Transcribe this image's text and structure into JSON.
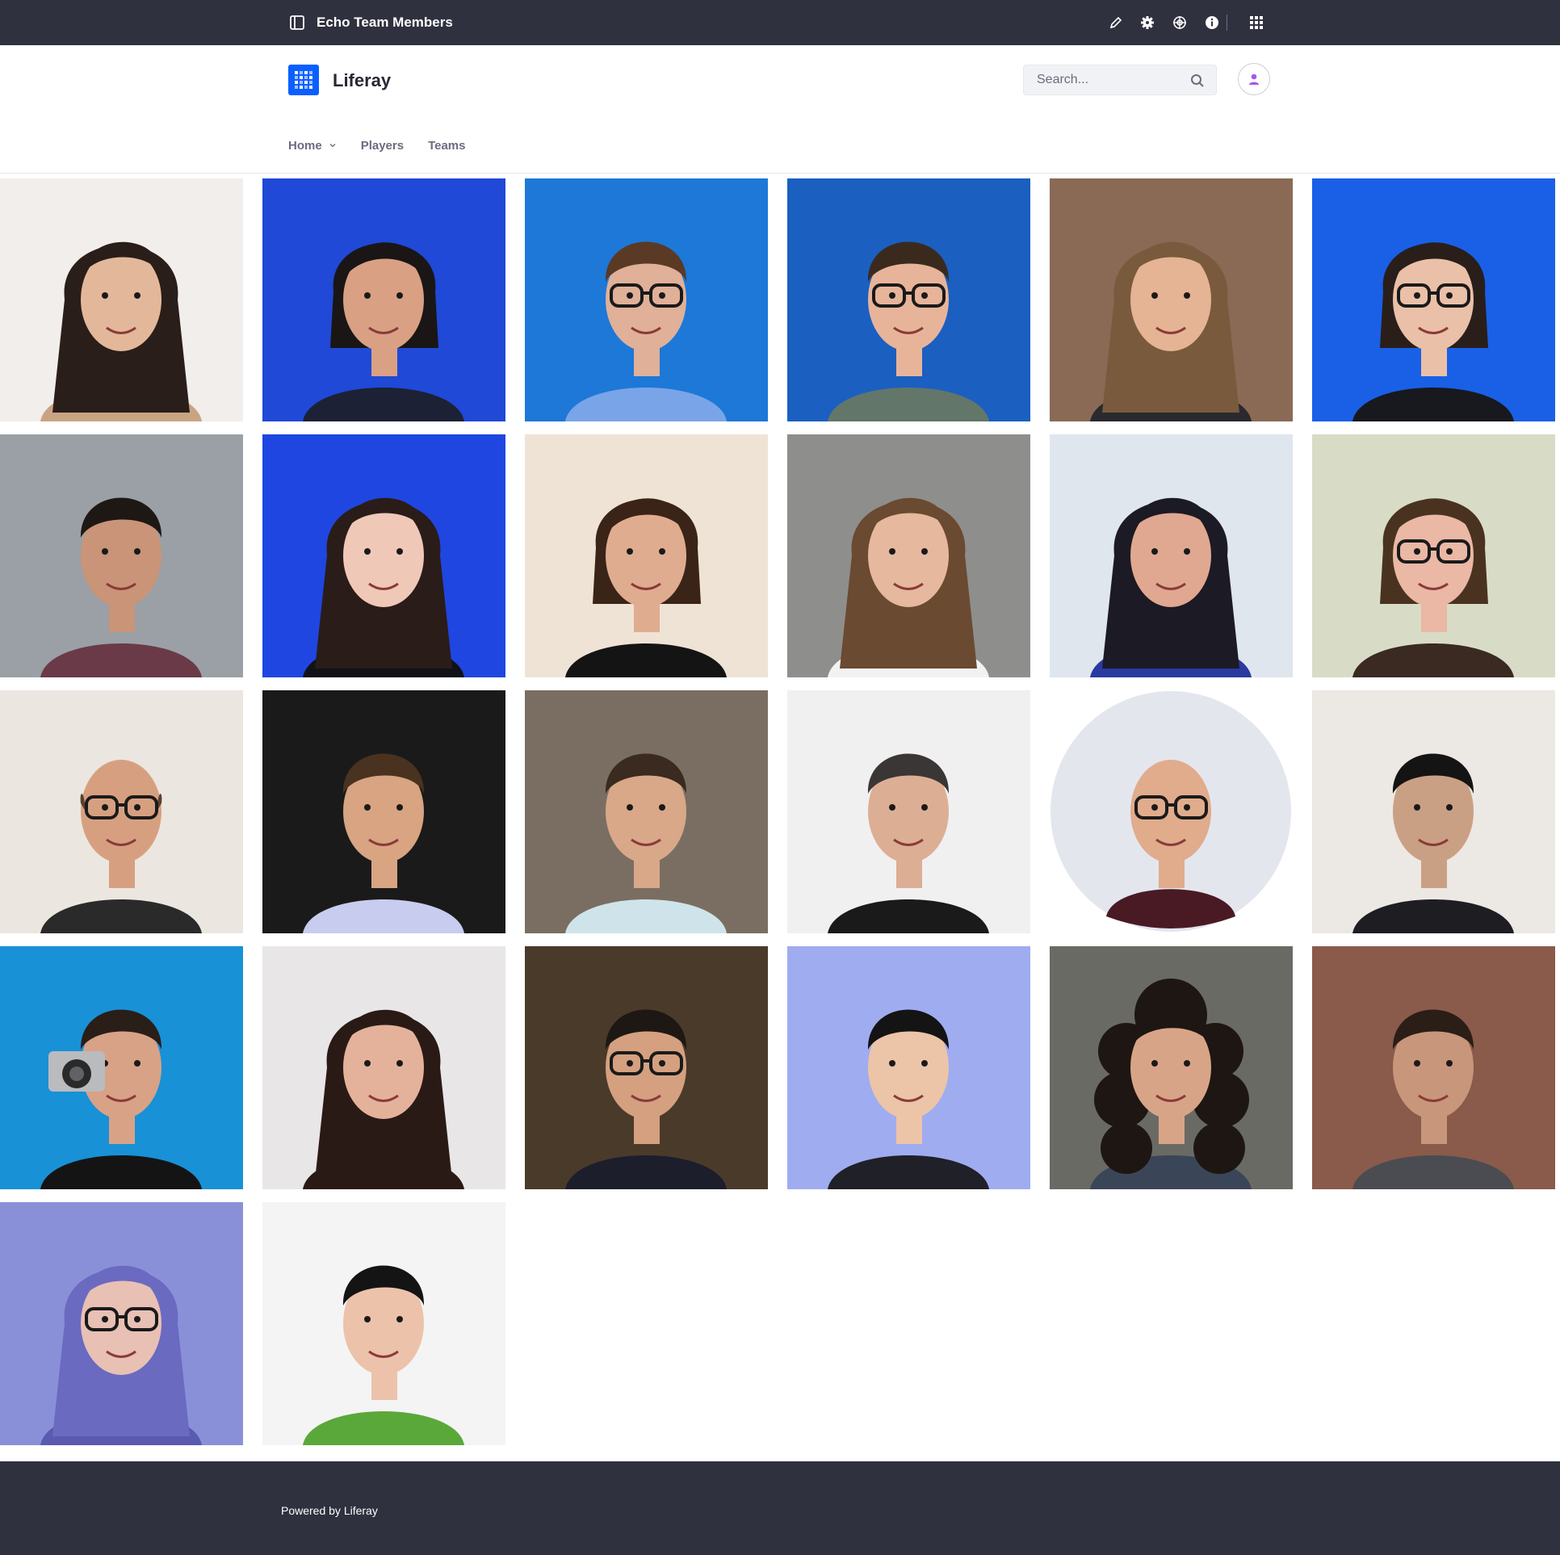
{
  "control_menu": {
    "title": "Echo Team Members",
    "icons": [
      "sidebar-toggle-icon",
      "pencil-icon",
      "gear-icon",
      "simulation-icon",
      "info-icon",
      "apps-grid-icon"
    ]
  },
  "header": {
    "site_name": "Liferay",
    "search_placeholder": "Search...",
    "nav": [
      {
        "label": "Home",
        "has_dropdown": true
      },
      {
        "label": "Players",
        "has_dropdown": false
      },
      {
        "label": "Teams",
        "has_dropdown": false
      }
    ]
  },
  "members": [
    {
      "bg": "#f1eeec",
      "skin": "#e3b89a",
      "hair": "#2a1e1a",
      "shirt": "#c9a483",
      "style": "long",
      "glasses": false
    },
    {
      "bg": "#1f49d6",
      "skin": "#d9a084",
      "hair": "#1a1616",
      "shirt": "#1c2135",
      "style": "bob",
      "glasses": false
    },
    {
      "bg": "#1d78d8",
      "skin": "#e0b098",
      "hair": "#5a3a24",
      "shirt": "#7aa4e8",
      "style": "short",
      "glasses": true
    },
    {
      "bg": "#1b5fc1",
      "skin": "#e7b49a",
      "hair": "#3a2a1e",
      "shirt": "#63766a",
      "style": "short",
      "glasses": true
    },
    {
      "bg": "#8a6a55",
      "skin": "#e4b494",
      "hair": "#7a5a3c",
      "shirt": "#2a2a2e",
      "style": "long",
      "glasses": false
    },
    {
      "bg": "#1960e6",
      "skin": "#eac0a8",
      "hair": "#2a1e1a",
      "shirt": "#18191e",
      "style": "bob",
      "glasses": true
    },
    {
      "bg": "#9aa0a6",
      "skin": "#c99478",
      "hair": "#1e1814",
      "shirt": "#6b3a48",
      "style": "short",
      "glasses": false
    },
    {
      "bg": "#1f46e0",
      "skin": "#f0c8b8",
      "hair": "#2a1c18",
      "shirt": "#111218",
      "style": "long",
      "glasses": false
    },
    {
      "bg": "#efe3d6",
      "skin": "#e0ac90",
      "hair": "#3a2418",
      "shirt": "#141414",
      "style": "bob",
      "glasses": false
    },
    {
      "bg": "#8e8e8c",
      "skin": "#e6b89e",
      "hair": "#6a4a30",
      "shirt": "#f2f2f2",
      "style": "long",
      "glasses": false
    },
    {
      "bg": "#dfe6ee",
      "skin": "#e0a890",
      "hair": "#1c1a24",
      "shirt": "#2a3aa0",
      "style": "long",
      "glasses": false
    },
    {
      "bg": "#d8dcc6",
      "skin": "#eab8a4",
      "hair": "#4a3220",
      "shirt": "#3a2a22",
      "style": "bob",
      "glasses": true
    },
    {
      "bg": "#ece6e0",
      "skin": "#d6a080",
      "hair": "#5a4030",
      "shirt": "#2a2a2a",
      "style": "bald",
      "glasses": true
    },
    {
      "bg": "#1a1a1a",
      "skin": "#d8a482",
      "hair": "#4a3220",
      "shirt": "#c8ccee",
      "style": "short",
      "glasses": false
    },
    {
      "bg": "#7a6e62",
      "skin": "#d8a888",
      "hair": "#3a2a20",
      "shirt": "#cfe4ea",
      "style": "short",
      "glasses": false
    },
    {
      "bg": "#f0f0f0",
      "skin": "#dcae94",
      "hair": "#3a3636",
      "shirt": "#1a1a1a",
      "style": "short",
      "glasses": false
    },
    {
      "bg": "#ffffff",
      "skin": "#e0ac8c",
      "hair": "#1e1814",
      "shirt": "#4a1a24",
      "style": "circle",
      "glasses": true
    },
    {
      "bg": "#ece8e4",
      "skin": "#caa084",
      "hair": "#141414",
      "shirt": "#1e1e22",
      "style": "short",
      "glasses": false
    },
    {
      "bg": "#1891d6",
      "skin": "#d8a286",
      "hair": "#2a1e18",
      "shirt": "#141414",
      "style": "camera",
      "glasses": false
    },
    {
      "bg": "#e8e6e6",
      "skin": "#e4b29a",
      "hair": "#2a1a16",
      "shirt": "#2a1a16",
      "style": "long",
      "glasses": false
    },
    {
      "bg": "#4a3a2a",
      "skin": "#d4a080",
      "hair": "#1e1814",
      "shirt": "#1c1e2c",
      "style": "short",
      "glasses": true
    },
    {
      "bg": "#a0acf0",
      "skin": "#ecc4a8",
      "hair": "#141414",
      "shirt": "#202028",
      "style": "short",
      "glasses": false
    },
    {
      "bg": "#6a6a64",
      "skin": "#d8a488",
      "hair": "#1e1612",
      "shirt": "#3a4658",
      "style": "curly",
      "glasses": false
    },
    {
      "bg": "#8a5a4a",
      "skin": "#c8967a",
      "hair": "#2a1e16",
      "shirt": "#4a4c52",
      "style": "short",
      "glasses": false
    },
    {
      "bg": "#8a90d8",
      "skin": "#e8c0b4",
      "hair": "#6a6ac0",
      "shirt": "#5a5ab0",
      "style": "long",
      "glasses": true
    },
    {
      "bg": "#f4f4f4",
      "skin": "#ecc2aa",
      "hair": "#141414",
      "shirt": "#5aa83a",
      "style": "short",
      "glasses": false
    }
  ],
  "footer": {
    "text": "Powered by Liferay"
  }
}
